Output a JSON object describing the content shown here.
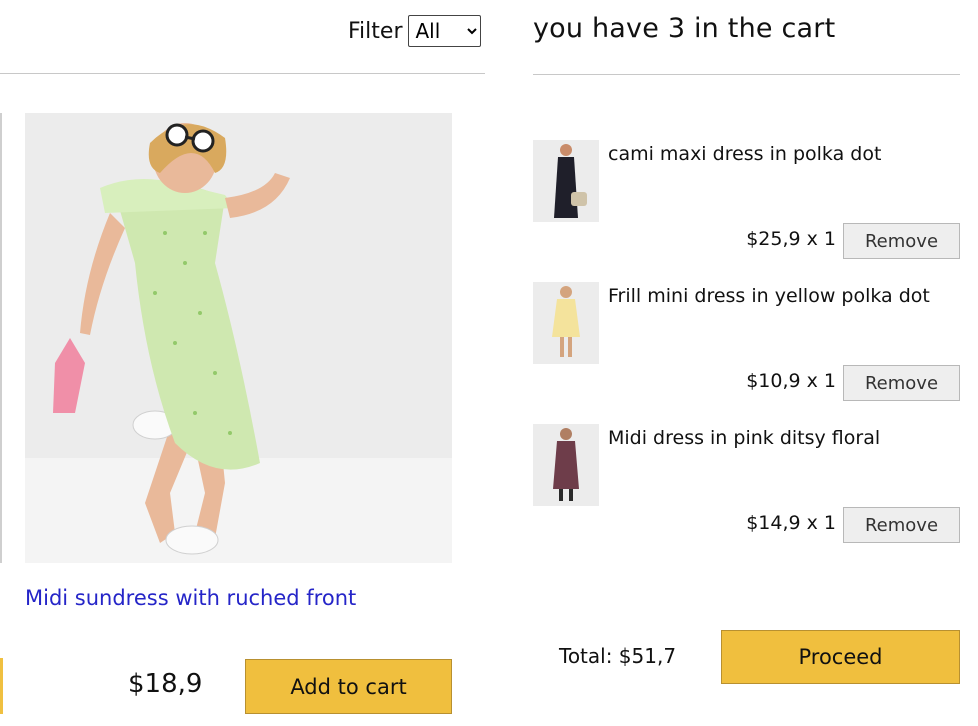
{
  "filter": {
    "label": "Filter",
    "selected": "All",
    "options": [
      "All"
    ]
  },
  "product": {
    "title": "Midi sundress with ruched front",
    "price": "$18,9",
    "add_label": "Add to cart",
    "image_icon": "photo-model-green-dress"
  },
  "cart": {
    "header": "you have 3 in the cart",
    "items": [
      {
        "title": "cami maxi dress in polka dot",
        "price_qty": "$25,9 x 1",
        "remove_label": "Remove"
      },
      {
        "title": "Frill mini dress in yellow polka dot",
        "price_qty": "$10,9 x 1",
        "remove_label": "Remove"
      },
      {
        "title": "Midi dress in pink ditsy floral",
        "price_qty": "$14,9 x 1",
        "remove_label": "Remove"
      }
    ],
    "total": "Total: $51,7",
    "proceed_label": "Proceed"
  },
  "colors": {
    "accent": "#f0bf3e",
    "link": "#2525c8",
    "remove_bg": "#eeeeee"
  }
}
